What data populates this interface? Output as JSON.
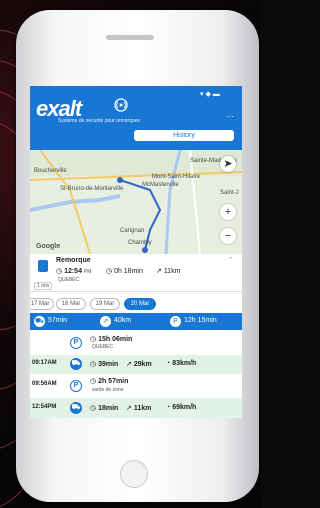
{
  "app": {
    "logo": "exalt",
    "tagline": "Système de sécurité pour remorques",
    "status": "▾ ◆ ▬",
    "more": "…"
  },
  "header": {
    "history_label": "History"
  },
  "map": {
    "labels": [
      "Boucherville",
      "St-Bruno-de-Montarville",
      "Mont-Saint-Hilaire",
      "McMasterville",
      "Sainte-Madeleine",
      "Carignan",
      "Chambly",
      "Saint-J",
      "Saint-Marc-sur-Richelieu"
    ],
    "route_shields": [
      "116",
      "112",
      "133",
      "10"
    ],
    "google": "Google"
  },
  "card": {
    "title": "Remorque",
    "time": "12:54",
    "time_suffix": "PM",
    "duration": "0h 18min",
    "distance": "11km",
    "location": "QUEBEC",
    "badge": "1 min"
  },
  "dates": [
    {
      "label": "17 Mar",
      "selected": false
    },
    {
      "label": "18 Mar",
      "selected": false
    },
    {
      "label": "19 Mar",
      "selected": false
    },
    {
      "label": "20 Mar",
      "selected": true
    }
  ],
  "summary": {
    "drive": "57min",
    "distance": "40km",
    "parking": "12h 15min"
  },
  "events": [
    {
      "time": "",
      "duration": "15h 06min",
      "place": "QUEBEC"
    },
    {
      "time": "09:17AM",
      "duration": "39min",
      "distance": "29km",
      "speed": "83km/h"
    },
    {
      "time": "09:56AM",
      "duration": "2h 57min",
      "note": "sortie de zone"
    },
    {
      "time": "12:54PM",
      "duration": "18min",
      "distance": "11km",
      "speed": "69km/h"
    }
  ]
}
